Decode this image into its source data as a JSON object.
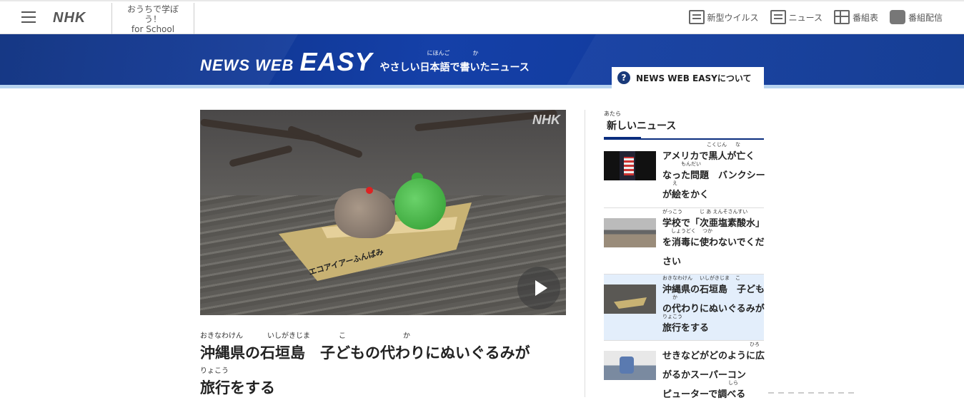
{
  "header": {
    "logo": "NHK",
    "school_line1": "おうちで学ぼ",
    "school_line2": "う！",
    "school_line3": "for School",
    "nav": [
      {
        "label": "新型ウイルス",
        "icon": "virus-info-icon"
      },
      {
        "label": "ニュース",
        "icon": "news-icon"
      },
      {
        "label": "番組表",
        "icon": "program-guide-icon"
      },
      {
        "label": "番組配信",
        "icon": "streaming-icon"
      }
    ]
  },
  "banner": {
    "brand_news": "NEWS WEB",
    "brand_easy": "EASY",
    "subtitle": "やさしい日本語で書いたニュース",
    "subtitle_ruby1": "にほんご",
    "subtitle_ruby2": "か",
    "about_label": "NEWS WEB EASYについて",
    "about_icon": "?"
  },
  "main": {
    "image_watermark": "NHK",
    "boat_text": "エコアイアーふんばみ",
    "headline_line1": "沖縄県の石垣島　子どもの代わりにぬいぐるみが",
    "headline_ruby1a": "おきなわけん",
    "headline_ruby1b": "いしがきじま",
    "headline_ruby1c": "こ",
    "headline_ruby1d": "か",
    "headline_line2": "旅行をする",
    "headline_ruby2": "りょこう"
  },
  "sidebar": {
    "title": "新しいニュース",
    "title_ruby": "あたら",
    "items": [
      {
        "lines": [
          "アメリカで黒人が亡く",
          "なった問題　バンクシー",
          "が絵をかく"
        ],
        "rubies": [
          [
            "こくじん",
            "な"
          ],
          [
            "もんだい"
          ],
          [
            "え"
          ]
        ]
      },
      {
        "lines": [
          "学校で「次亜塩素酸水」",
          "を消毒に使わないでくだ",
          "さい"
        ],
        "rubies": [
          [
            "がっこう",
            "じ あ えんそさんすい"
          ],
          [
            "しょうどく",
            "つか"
          ],
          []
        ]
      },
      {
        "lines": [
          "沖縄県の石垣島　子ども",
          "の代わりにぬいぐるみが",
          "旅行をする"
        ],
        "rubies": [
          [
            "おきなわけん",
            "いしがきじま",
            "こ"
          ],
          [
            "か"
          ],
          [
            "りょこう"
          ]
        ]
      },
      {
        "lines": [
          "せきなどがどのように広",
          "がるかスーパーコン",
          "ピューターで調べる"
        ],
        "rubies": [
          [
            "ひろ"
          ],
          [],
          [
            "しら"
          ]
        ]
      }
    ]
  }
}
